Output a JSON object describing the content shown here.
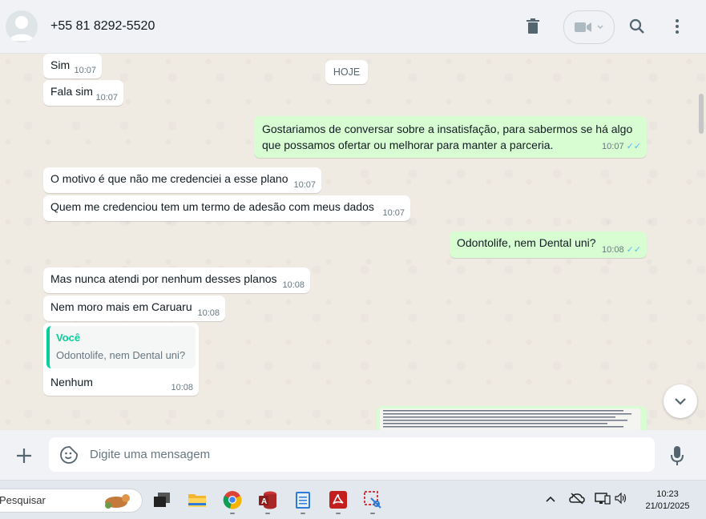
{
  "header": {
    "contact_name": "+55 81 8292-5520",
    "icons": [
      "avatar-placeholder",
      "delete-icon",
      "video-call-icon",
      "chevron-down-icon",
      "search-icon",
      "menu-icon"
    ]
  },
  "chat": {
    "date_chip": "HOJE",
    "messages": [
      {
        "dir": "in",
        "text": "Sim",
        "time": "10:07"
      },
      {
        "dir": "in",
        "text": "Fala sim",
        "time": "10:07"
      },
      {
        "dir": "out",
        "line1": "Gostariamos de conversar sobre a insatisfação, para sabermos se há algo",
        "line2": "que possamos ofertar ou melhorar para manter a parceria.",
        "time": "10:07",
        "status": "read"
      },
      {
        "dir": "in",
        "text": "O motivo é que não me credenciei a esse plano",
        "time": "10:07"
      },
      {
        "dir": "in",
        "text": "Quem me credenciou tem um termo de adesão com meus dados",
        "time": "10:07"
      },
      {
        "dir": "out",
        "text": "Odontolife, nem Dental uni?",
        "time": "10:08",
        "status": "read"
      },
      {
        "dir": "in",
        "text": "Mas nunca atendi por nenhum desses planos",
        "time": "10:08"
      },
      {
        "dir": "in",
        "text": "Nem moro mais em Caruaru",
        "time": "10:08"
      },
      {
        "dir": "in",
        "quote_author": "Você",
        "quote_text": "Odontolife, nem Dental uni?",
        "text": "Nenhum",
        "time": "10:08"
      }
    ],
    "attachment": "document-image-preview"
  },
  "footer": {
    "placeholder": "Digite uma mensagem",
    "icons": [
      "plus-icon",
      "sticker-icon",
      "microphone-icon"
    ]
  },
  "taskbar": {
    "search_placeholder": "Pesquisar",
    "apps": [
      "task-view-icon",
      "file-explorer-icon",
      "chrome-icon",
      "access-icon",
      "notepad-icon",
      "acrobat-icon",
      "snipping-tool-icon"
    ],
    "time": "10:23",
    "date": "21/01/2025"
  },
  "colors": {
    "incoming_bubble": "#ffffff",
    "outgoing_bubble": "#d9fdd3",
    "read_ticks": "#53bdeb",
    "quote_accent": "#06cf9c",
    "chat_background": "#efeae2"
  }
}
